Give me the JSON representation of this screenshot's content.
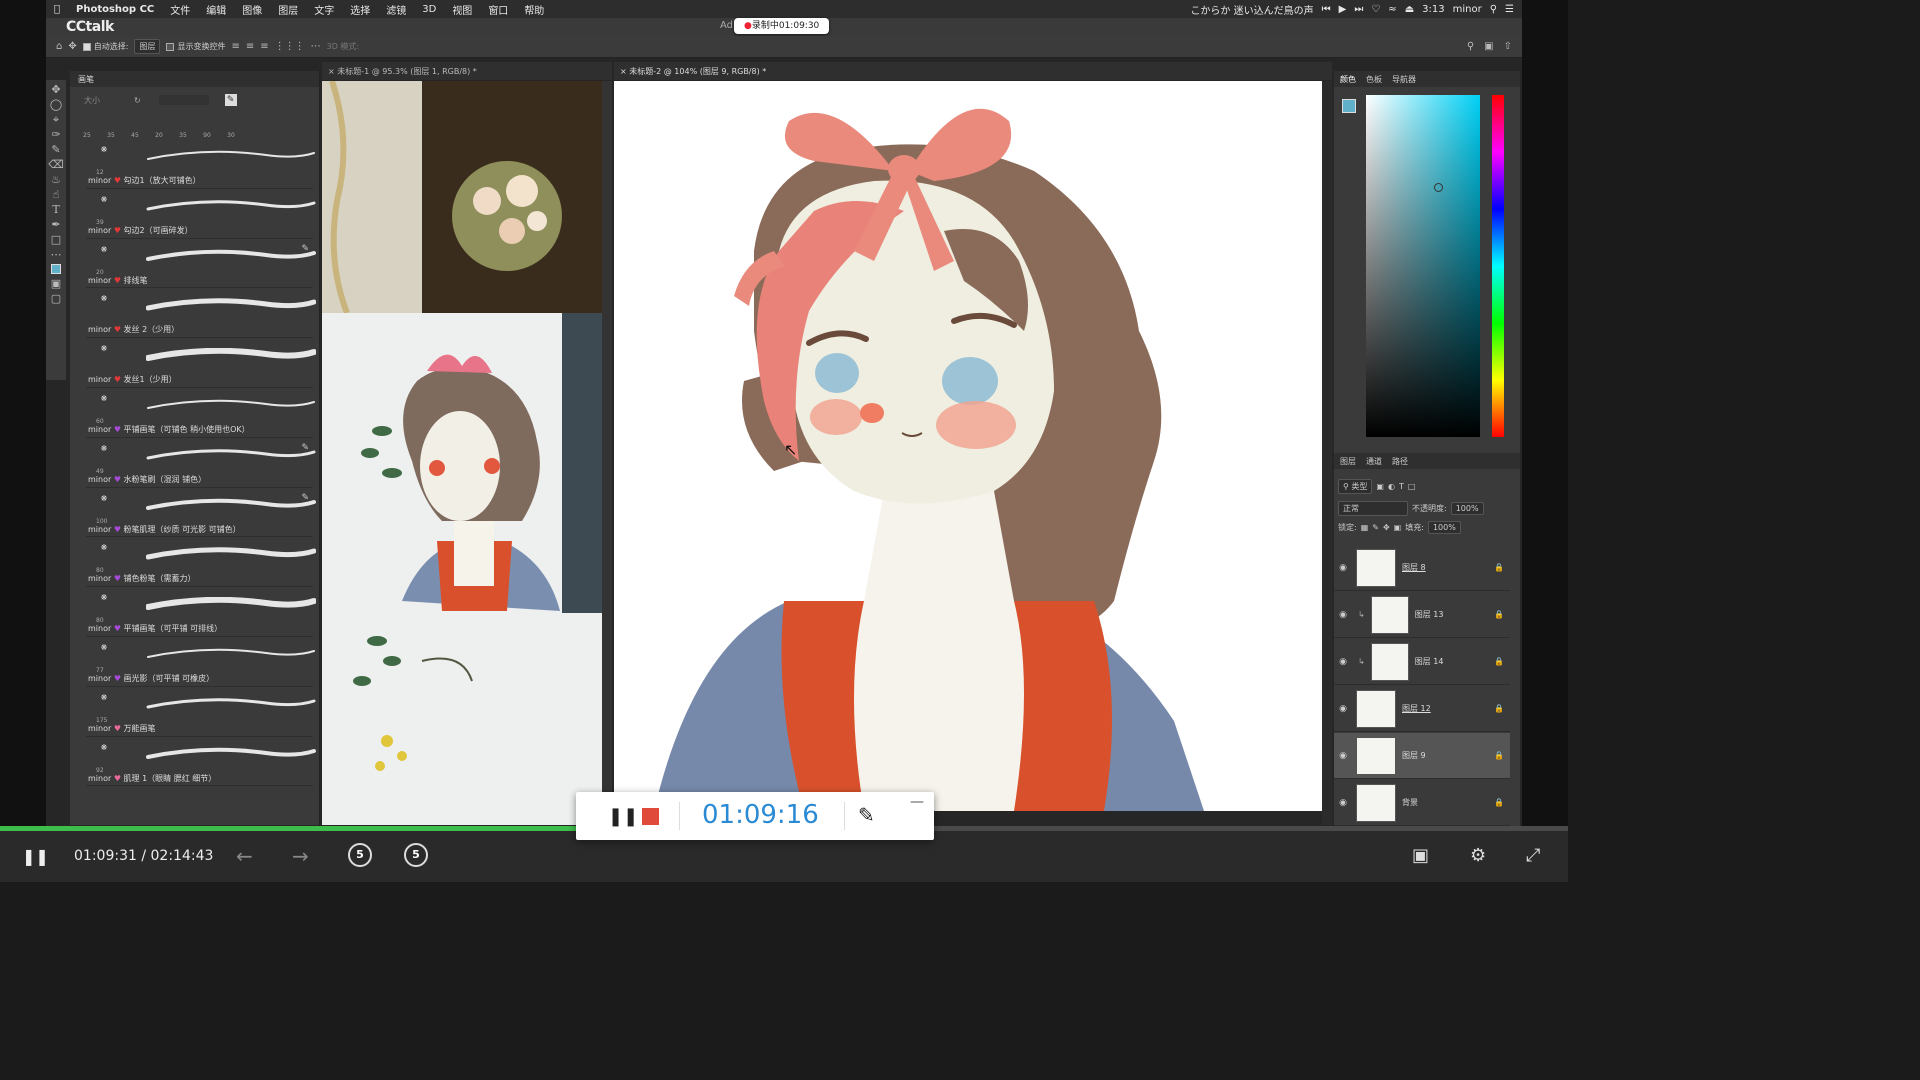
{
  "menubar": {
    "app_name": "Photoshop CC",
    "menus": [
      "文件",
      "编辑",
      "图像",
      "图层",
      "文字",
      "选择",
      "滤镜",
      "3D",
      "视图",
      "窗口",
      "帮助"
    ],
    "song": "こからか 迷い込んだ鳥の声",
    "clock": "3:13",
    "user": "minor"
  },
  "cctalk": {
    "logo": "CCtalk",
    "ad_text": "Ad",
    "recording_badge": "录制中01:09:30"
  },
  "options_bar": {
    "auto_select_label": "自动选择:",
    "auto_select_value": "图层",
    "show_transform_label": "显示变换控件",
    "mode_label": "3D 模式:"
  },
  "brush_panel": {
    "tab_label": "画笔",
    "size_placeholder": "大小",
    "presets": [
      "25",
      "35",
      "45",
      "20",
      "35",
      "90",
      "30"
    ],
    "brushes": [
      {
        "size": "12",
        "author": "minor",
        "heart": "red",
        "label": "勾边1（放大可铺色）"
      },
      {
        "size": "39",
        "author": "minor",
        "heart": "red",
        "label": "勾边2（可画碎发）"
      },
      {
        "size": "20",
        "author": "minor",
        "heart": "red",
        "label": "排线笔"
      },
      {
        "size": "",
        "author": "minor",
        "heart": "red",
        "label": "发丝 2（少用）"
      },
      {
        "size": "",
        "author": "minor",
        "heart": "red",
        "label": "发丝1（少用）"
      },
      {
        "size": "60",
        "author": "minor",
        "heart": "purple",
        "label": "平铺画笔（可铺色 稍小使用也OK）"
      },
      {
        "size": "49",
        "author": "minor",
        "heart": "purple",
        "label": "水粉笔刷（湿润 铺色）"
      },
      {
        "size": "100",
        "author": "minor",
        "heart": "purple",
        "label": "粉笔肌理（纱质 可光影 可铺色）"
      },
      {
        "size": "80",
        "author": "minor",
        "heart": "purple",
        "label": "铺色粉笔（需蓄力）"
      },
      {
        "size": "80",
        "author": "minor",
        "heart": "purple",
        "label": "平铺画笔（可平铺 可排线）"
      },
      {
        "size": "77",
        "author": "minor",
        "heart": "purple",
        "label": "画光影（可平铺 可橡皮）"
      },
      {
        "size": "175",
        "author": "minor",
        "heart": "pink",
        "label": "万能画笔"
      },
      {
        "size": "92",
        "author": "minor",
        "heart": "pink",
        "label": "肌理 1（眼睛 腮红 细节）"
      }
    ]
  },
  "documents": {
    "reference_tab": "未标题-1 @ 95.3% (图层 1, RGB/8) *",
    "main_tab": "未标题-2 @ 104% (图层 9, RGB/8) *"
  },
  "right_panel": {
    "color_tabs": [
      "颜色",
      "色板",
      "导航器"
    ],
    "layer_tabs": [
      "图层",
      "通道",
      "路径"
    ],
    "filter_label": "类型",
    "blend_mode": "正常",
    "opacity_label": "不透明度:",
    "opacity_value": "100%",
    "lock_label": "锁定:",
    "fill_label": "填充:",
    "fill_value": "100%",
    "layers": [
      {
        "name": "图层 8",
        "clipped": false,
        "selected": false
      },
      {
        "name": "图层 13",
        "clipped": true,
        "selected": false
      },
      {
        "name": "图层 14",
        "clipped": true,
        "selected": false
      },
      {
        "name": "图层 12",
        "clipped": false,
        "selected": false
      },
      {
        "name": "图层 9",
        "clipped": false,
        "selected": true
      },
      {
        "name": "背景",
        "clipped": false,
        "selected": false
      }
    ]
  },
  "recorder": {
    "elapsed": "01:09:16"
  },
  "player": {
    "current_time": "01:09:31",
    "separator": "/",
    "total_time": "02:14:43",
    "skip_back": "5",
    "skip_forward": "5",
    "progress_fraction": 0.368
  },
  "colors": {
    "accent_green": "#3dbd4b",
    "recorder_blue": "#2a8ad4",
    "stop_red": "#e04a3a",
    "hair_brown": "#8a6a58",
    "skin": "#efeee0",
    "bow_pink": "#e98a7d",
    "vest_orange": "#d9512c",
    "sleeve_blue": "#7689aa",
    "eye_blue": "#9cc3d6"
  }
}
